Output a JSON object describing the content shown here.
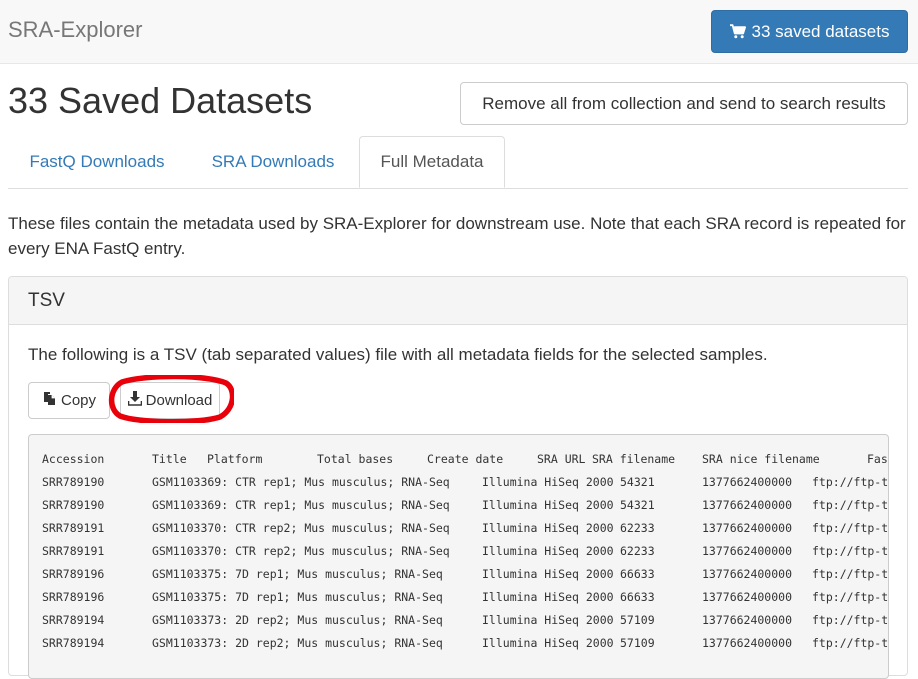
{
  "navbar": {
    "brand": "SRA-Explorer",
    "saved_button_label": "33 saved datasets",
    "saved_button_icon": "shopping-cart-icon"
  },
  "header": {
    "title": "33 Saved Datasets",
    "remove_button_label": "Remove all from collection and send to search results"
  },
  "tabs": [
    {
      "label": "FastQ Downloads",
      "active": false
    },
    {
      "label": "SRA Downloads",
      "active": false
    },
    {
      "label": "Full Metadata",
      "active": true
    }
  ],
  "description": "These files contain the metadata used by SRA-Explorer for downstream use. Note that each SRA record is repeated for every ENA FastQ entry.",
  "tsv_panel": {
    "heading": "TSV",
    "text": "The following is a TSV (tab separated values) file with all metadata fields for the selected samples.",
    "copy_label": "Copy",
    "download_label": "Download",
    "highlight_color": "#e8000b",
    "columns": [
      "Accession",
      "Title",
      "Platform",
      "Total bases",
      "Create date",
      "SRA URL",
      "SRA filename",
      "SRA nice filename",
      "Fas"
    ],
    "rows": [
      [
        "SRR789190",
        "GSM1103369: CTR rep1; Mus musculus; RNA-Seq",
        "Illumina HiSeq 2000",
        "54321",
        "1377662400000",
        "ftp://ftp-t"
      ],
      [
        "SRR789190",
        "GSM1103369: CTR rep1; Mus musculus; RNA-Seq",
        "Illumina HiSeq 2000",
        "54321",
        "1377662400000",
        "ftp://ftp-t"
      ],
      [
        "SRR789191",
        "GSM1103370: CTR rep2; Mus musculus; RNA-Seq",
        "Illumina HiSeq 2000",
        "62233",
        "1377662400000",
        "ftp://ftp-t"
      ],
      [
        "SRR789191",
        "GSM1103370: CTR rep2; Mus musculus; RNA-Seq",
        "Illumina HiSeq 2000",
        "62233",
        "1377662400000",
        "ftp://ftp-t"
      ],
      [
        "SRR789196",
        "GSM1103375: 7D rep1; Mus musculus; RNA-Seq",
        "Illumina HiSeq 2000",
        "66633",
        "1377662400000",
        "ftp://ftp-t"
      ],
      [
        "SRR789196",
        "GSM1103375: 7D rep1; Mus musculus; RNA-Seq",
        "Illumina HiSeq 2000",
        "66633",
        "1377662400000",
        "ftp://ftp-t"
      ],
      [
        "SRR789194",
        "GSM1103373: 2D rep2; Mus musculus; RNA-Seq",
        "Illumina HiSeq 2000",
        "57109",
        "1377662400000",
        "ftp://ftp-t"
      ],
      [
        "SRR789194",
        "GSM1103373: 2D rep2; Mus musculus; RNA-Seq",
        "Illumina HiSeq 2000",
        "57109",
        "1377662400000",
        "ftp://ftp-t"
      ]
    ]
  },
  "colors": {
    "primary": "#337ab7",
    "link": "#337ab7",
    "navbar_bg": "#f8f8f8",
    "pre_bg": "#f5f5f5"
  }
}
